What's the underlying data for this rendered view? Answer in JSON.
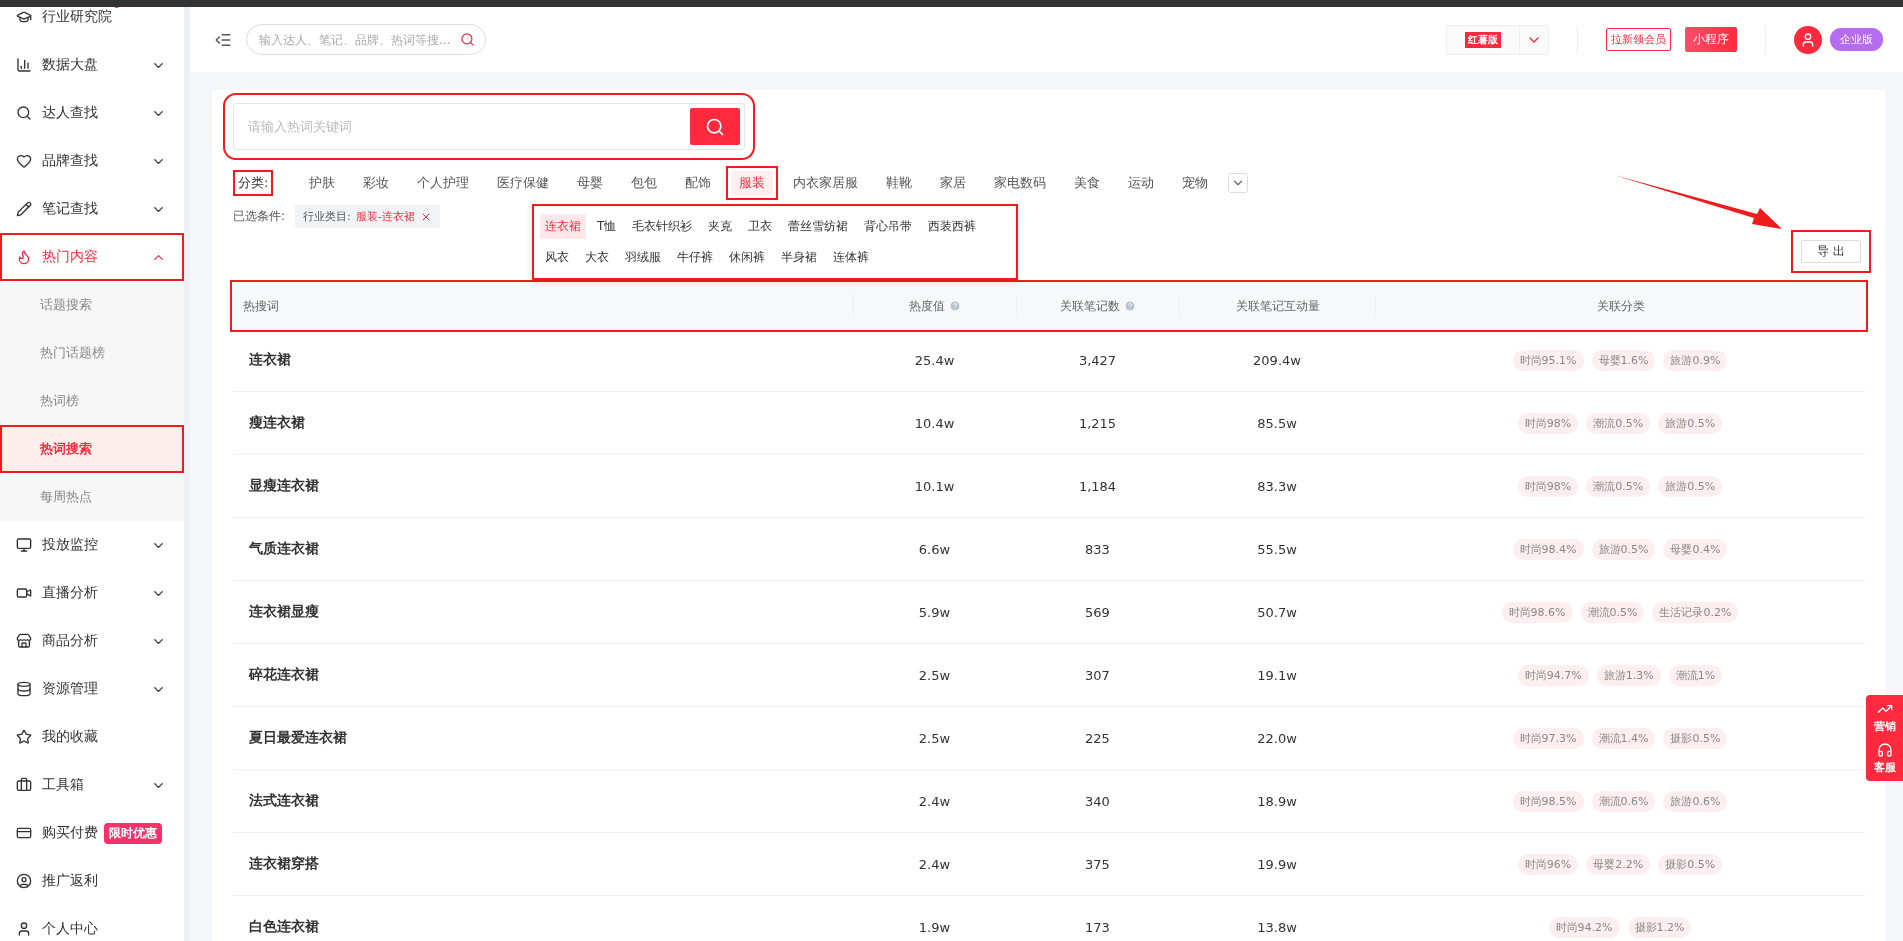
{
  "sidebar": {
    "items": [
      {
        "label": "行业研究院",
        "dot": true,
        "selected": false,
        "highlighted": false
      },
      {
        "label": "数据大盘",
        "expanded": false,
        "selected": false,
        "highlighted": false
      },
      {
        "label": "达人查找",
        "expanded": false,
        "selected": false,
        "highlighted": false
      },
      {
        "label": "品牌查找",
        "expanded": false,
        "selected": false,
        "highlighted": false
      },
      {
        "label": "笔记查找",
        "expanded": false,
        "selected": false,
        "highlighted": false
      },
      {
        "label": "热门内容",
        "expanded": true,
        "selected": true,
        "highlighted": true,
        "children": [
          {
            "label": "话题搜索",
            "selected": false,
            "highlighted": false
          },
          {
            "label": "热门话题榜",
            "selected": false,
            "highlighted": false
          },
          {
            "label": "热词榜",
            "selected": false,
            "highlighted": false
          },
          {
            "label": "热词搜索",
            "selected": true,
            "highlighted": true
          },
          {
            "label": "每周热点",
            "selected": false,
            "highlighted": false
          }
        ]
      },
      {
        "label": "投放监控",
        "expanded": false,
        "selected": false,
        "highlighted": false
      },
      {
        "label": "直播分析",
        "expanded": false,
        "selected": false,
        "highlighted": false
      },
      {
        "label": "商品分析",
        "expanded": false,
        "selected": false,
        "highlighted": false
      },
      {
        "label": "资源管理",
        "expanded": false,
        "selected": false,
        "highlighted": false
      },
      {
        "label": "我的收藏",
        "selected": false,
        "highlighted": false
      },
      {
        "label": "工具箱",
        "expanded": false,
        "selected": false,
        "highlighted": false
      },
      {
        "label": "购买付费",
        "badge": "限时优惠",
        "selected": false,
        "highlighted": false
      },
      {
        "label": "推广返利",
        "selected": false,
        "highlighted": false
      },
      {
        "label": "个人中心",
        "selected": false,
        "highlighted": false
      }
    ]
  },
  "topbar": {
    "search": {
      "placeholder": "输入达人、笔记、品牌、热词等搜..."
    },
    "version_select": "红薯版",
    "invite_button": "拉新领会员",
    "miniapp_button": "小程序",
    "plan_badge": "企业版"
  },
  "search": {
    "placeholder": "请输入热词关键词",
    "highlighted": true
  },
  "category": {
    "label": "分类:",
    "highlighted": true,
    "items": [
      {
        "label": "护肤",
        "selected": false
      },
      {
        "label": "彩妆",
        "selected": false
      },
      {
        "label": "个人护理",
        "selected": false
      },
      {
        "label": "医疗保健",
        "selected": false
      },
      {
        "label": "母婴",
        "selected": false
      },
      {
        "label": "包包",
        "selected": false
      },
      {
        "label": "配饰",
        "selected": false
      },
      {
        "label": "服装",
        "selected": true
      },
      {
        "label": "内衣家居服",
        "selected": false
      },
      {
        "label": "鞋靴",
        "selected": false
      },
      {
        "label": "家居",
        "selected": false
      },
      {
        "label": "家电数码",
        "selected": false
      },
      {
        "label": "美食",
        "selected": false
      },
      {
        "label": "运动",
        "selected": false
      },
      {
        "label": "宠物",
        "selected": false
      }
    ],
    "subcategories": {
      "highlighted": true,
      "items": [
        {
          "label": "连衣裙",
          "selected": true
        },
        {
          "label": "T恤",
          "selected": false
        },
        {
          "label": "毛衣针织衫",
          "selected": false
        },
        {
          "label": "夹克",
          "selected": false
        },
        {
          "label": "卫衣",
          "selected": false
        },
        {
          "label": "蕾丝雪纺裙",
          "selected": false
        },
        {
          "label": "背心吊带",
          "selected": false
        },
        {
          "label": "西装西裤",
          "selected": false
        },
        {
          "label": "风衣",
          "selected": false
        },
        {
          "label": "大衣",
          "selected": false
        },
        {
          "label": "羽绒服",
          "selected": false
        },
        {
          "label": "牛仔裤",
          "selected": false
        },
        {
          "label": "休闲裤",
          "selected": false
        },
        {
          "label": "半身裙",
          "selected": false
        },
        {
          "label": "连体裤",
          "selected": false
        }
      ]
    }
  },
  "conditions": {
    "label": "已选条件:",
    "chip": {
      "key": "行业类目:",
      "value": "服装-连衣裙"
    }
  },
  "export_button": {
    "label": "导 出",
    "highlighted": true
  },
  "table": {
    "highlighted": true,
    "columns": [
      {
        "label": "热搜词",
        "help": false
      },
      {
        "label": "热度值",
        "help": true
      },
      {
        "label": "关联笔记数",
        "help": true
      },
      {
        "label": "关联笔记互动量",
        "help": false
      },
      {
        "label": "关联分类",
        "help": false
      }
    ],
    "rows": [
      {
        "keyword": "连衣裙",
        "heat": "25.4w",
        "notes": "3,427",
        "interactions": "209.4w",
        "tags": [
          "时尚95.1%",
          "母婴1.6%",
          "旅游0.9%"
        ]
      },
      {
        "keyword": "瘦连衣裙",
        "heat": "10.4w",
        "notes": "1,215",
        "interactions": "85.5w",
        "tags": [
          "时尚98%",
          "潮流0.5%",
          "旅游0.5%"
        ]
      },
      {
        "keyword": "显瘦连衣裙",
        "heat": "10.1w",
        "notes": "1,184",
        "interactions": "83.3w",
        "tags": [
          "时尚98%",
          "潮流0.5%",
          "旅游0.5%"
        ]
      },
      {
        "keyword": "气质连衣裙",
        "heat": "6.6w",
        "notes": "833",
        "interactions": "55.5w",
        "tags": [
          "时尚98.4%",
          "旅游0.5%",
          "母婴0.4%"
        ]
      },
      {
        "keyword": "连衣裙显瘦",
        "heat": "5.9w",
        "notes": "569",
        "interactions": "50.7w",
        "tags": [
          "时尚98.6%",
          "潮流0.5%",
          "生活记录0.2%"
        ]
      },
      {
        "keyword": "碎花连衣裙",
        "heat": "2.5w",
        "notes": "307",
        "interactions": "19.1w",
        "tags": [
          "时尚94.7%",
          "旅游1.3%",
          "潮流1%"
        ]
      },
      {
        "keyword": "夏日最爱连衣裙",
        "heat": "2.5w",
        "notes": "225",
        "interactions": "22.0w",
        "tags": [
          "时尚97.3%",
          "潮流1.4%",
          "摄影0.5%"
        ]
      },
      {
        "keyword": "法式连衣裙",
        "heat": "2.4w",
        "notes": "340",
        "interactions": "18.9w",
        "tags": [
          "时尚98.5%",
          "潮流0.6%",
          "旅游0.6%"
        ]
      },
      {
        "keyword": "连衣裙穿搭",
        "heat": "2.4w",
        "notes": "375",
        "interactions": "19.9w",
        "tags": [
          "时尚96%",
          "母婴2.2%",
          "摄影0.5%"
        ]
      },
      {
        "keyword": "白色连衣裙",
        "heat": "1.9w",
        "notes": "173",
        "interactions": "13.8w",
        "tags": [
          "时尚94.2%",
          "摄影1.2%"
        ]
      }
    ]
  },
  "float_panel": [
    {
      "label": "营销"
    },
    {
      "label": "客服"
    }
  ]
}
